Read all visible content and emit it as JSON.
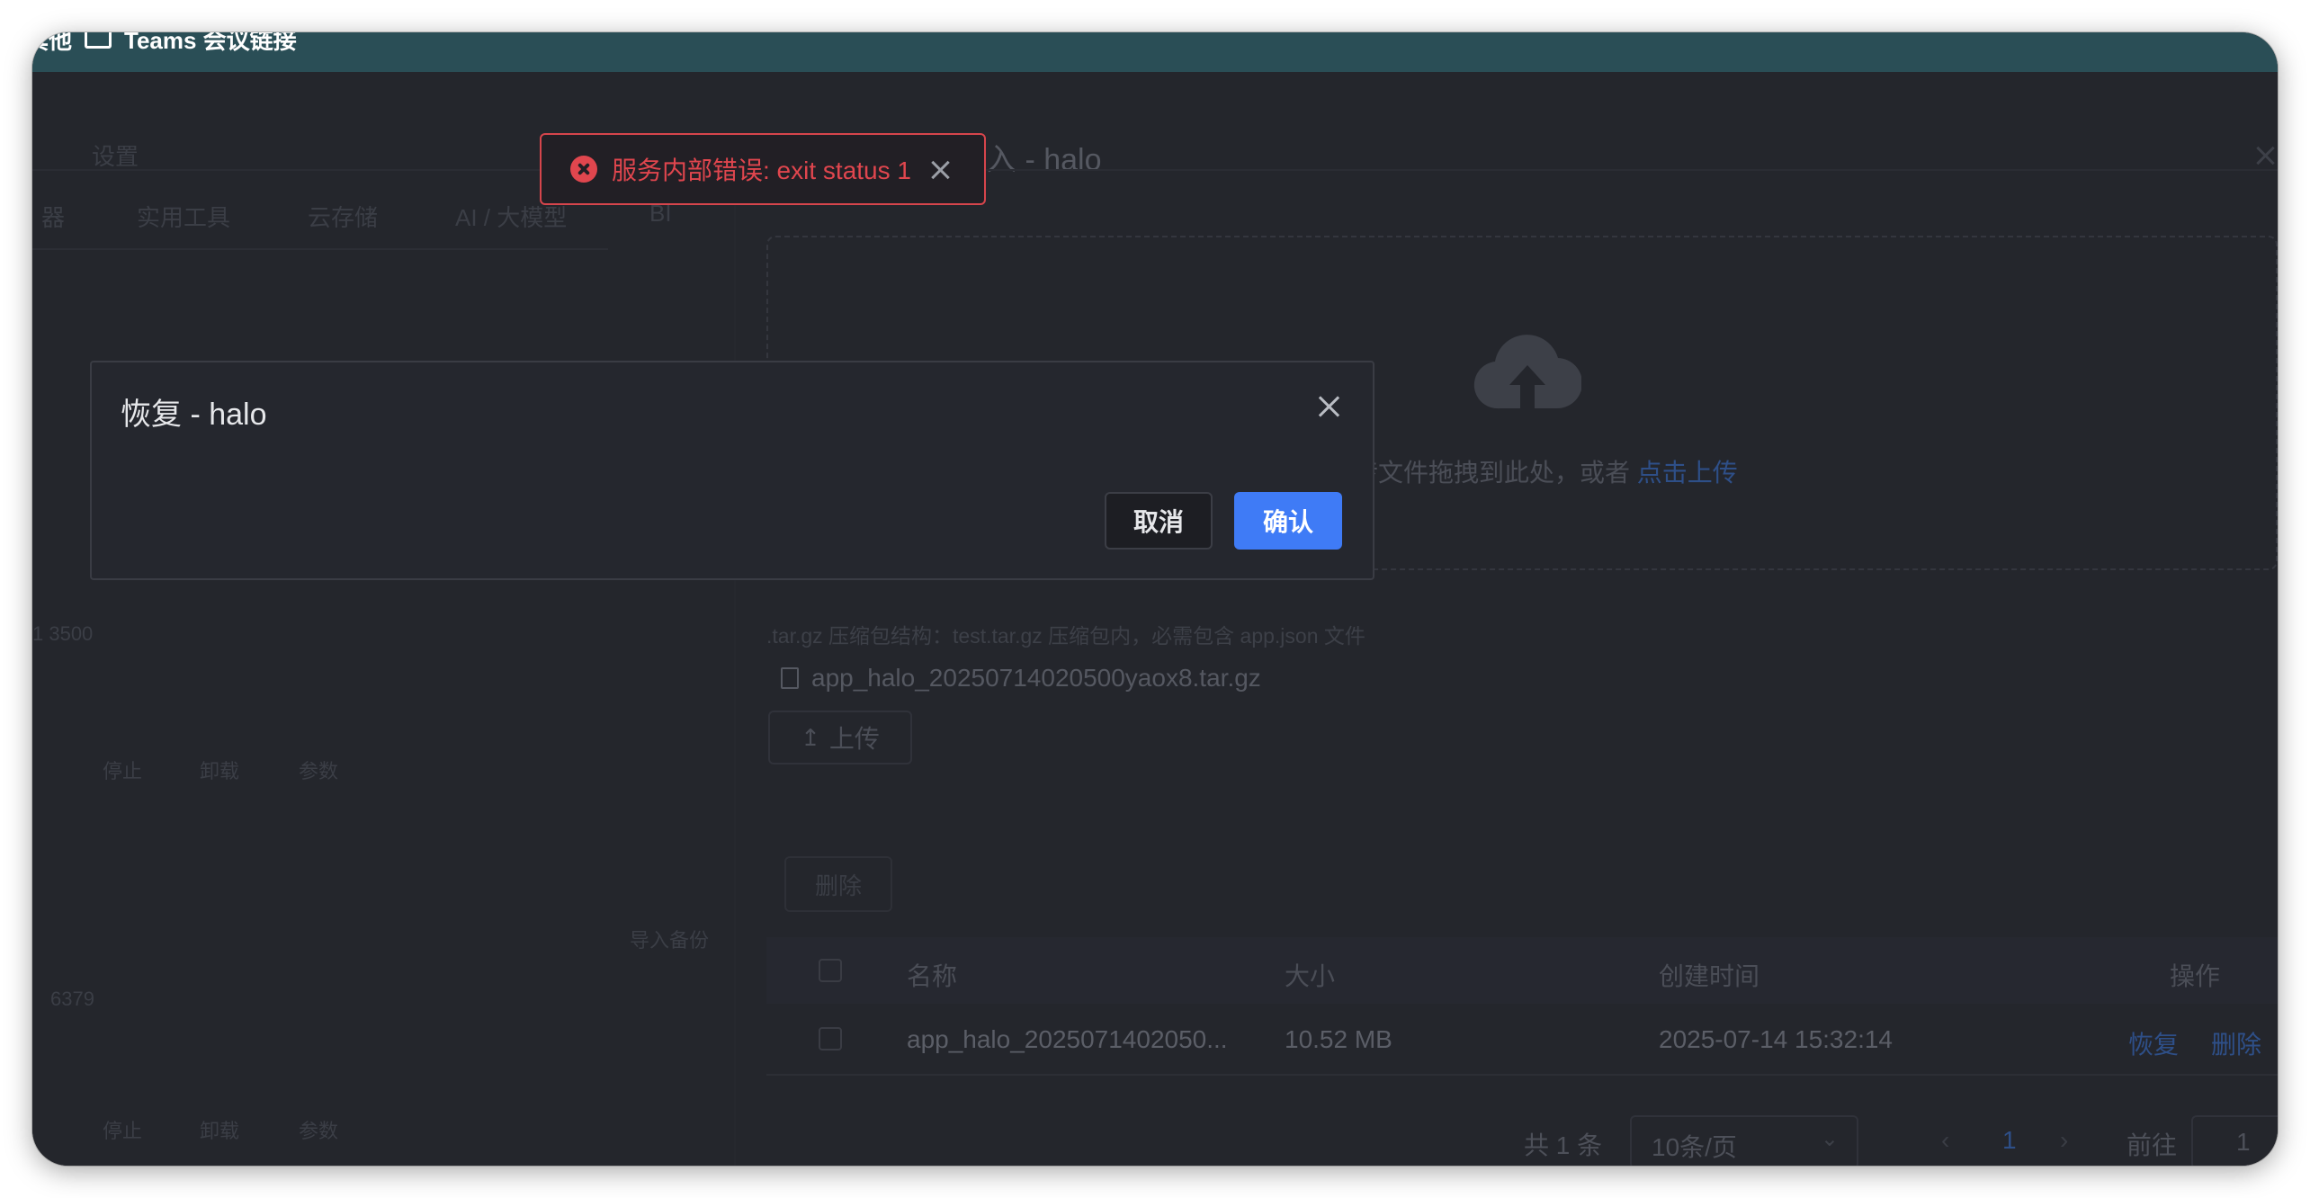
{
  "bookmarks": [
    {
      "label": "其他",
      "icon": "folder-icon"
    },
    {
      "label": "Teams 会议链接",
      "icon": "folder-icon"
    }
  ],
  "background": {
    "settings_label": "设置",
    "category_tabs": [
      "器",
      "实用工具",
      "云存储",
      "AI / 大模型",
      "BI"
    ],
    "port_a": "1 3500",
    "row_actions_a": [
      "停止",
      "卸载",
      "参数"
    ],
    "table_header_fragment": "导入备份",
    "port_b": "6379",
    "row_actions_b": [
      "停止",
      "卸载",
      "参数"
    ]
  },
  "drawer": {
    "title_fragment": "入 - halo",
    "upload": {
      "hint_text": "传文件拖拽到此处，或者 ",
      "hint_link": "点击上传",
      "tip": ".tar.gz 压缩包结构：test.tar.gz 压缩包内，必需包含 app.json 文件",
      "file_name": "app_halo_20250714020500yaox8.tar.gz",
      "upload_button": "上传"
    },
    "delete_button": "删除",
    "table": {
      "columns": [
        "名称",
        "大小",
        "创建时间",
        "操作"
      ],
      "rows": [
        {
          "name": "app_halo_2025071402050...",
          "size": "10.52 MB",
          "created": "2025-07-14 15:32:14",
          "actions": [
            "恢复",
            "删除"
          ]
        }
      ]
    },
    "pagination": {
      "total": "共 1 条",
      "page_size": "10条/页",
      "current_page": "1",
      "goto_label": "前往",
      "goto_value": "1"
    }
  },
  "toast": {
    "type": "error",
    "message": "服务内部错误: exit status 1"
  },
  "dialog": {
    "title": "恢复 - halo",
    "cancel_label": "取消",
    "confirm_label": "确认"
  }
}
